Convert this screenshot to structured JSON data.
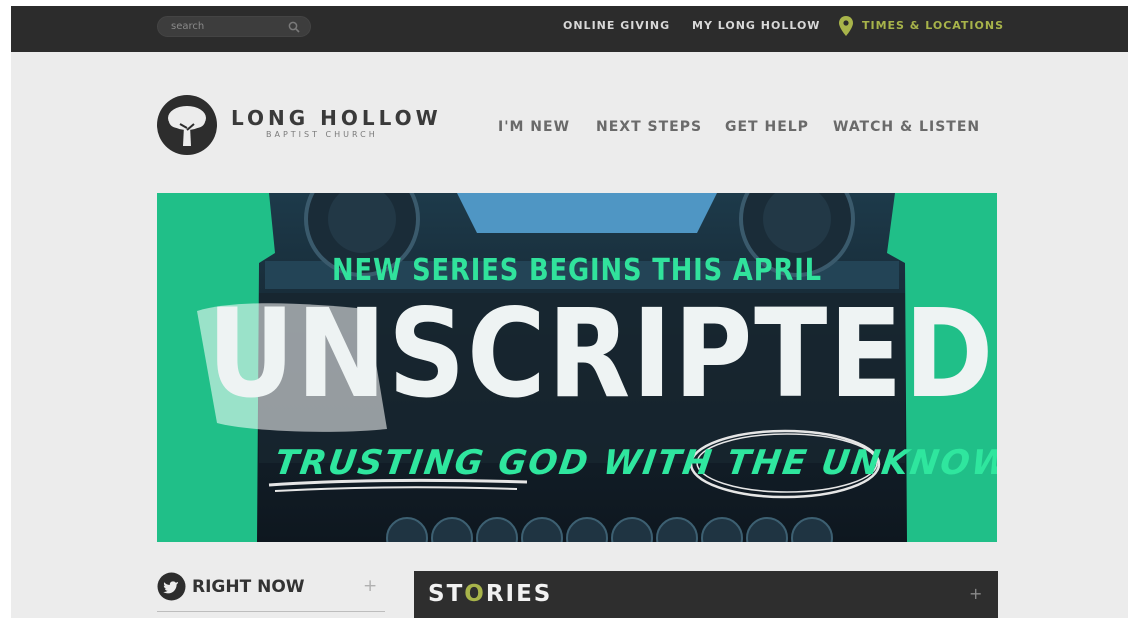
{
  "topbar": {
    "search_placeholder": "search",
    "links": [
      "ONLINE GIVING",
      "MY LONG HOLLOW"
    ],
    "locations_label": "TIMES & LOCATIONS"
  },
  "brand": {
    "name": "LONG HOLLOW",
    "subtitle": "BAPTIST CHURCH"
  },
  "nav": [
    "I'M NEW",
    "NEXT STEPS",
    "GET HELP",
    "WATCH & LISTEN"
  ],
  "hero": {
    "tagline": "NEW SERIES BEGINS THIS APRIL",
    "title": "UNSCRIPTED",
    "subtitle": "TRUSTING GOD WITH THE UNKNOWN"
  },
  "right_now": {
    "label": "RIGHT NOW",
    "expand": "+"
  },
  "stories": {
    "title_pre": "ST",
    "title_o": "O",
    "title_post": "RIES",
    "expand": "+"
  },
  "colors": {
    "topbar": "#2c2c2c",
    "accent": "#a8b44a",
    "hero_green": "#22c48c",
    "hero_text": "#31e29c"
  }
}
